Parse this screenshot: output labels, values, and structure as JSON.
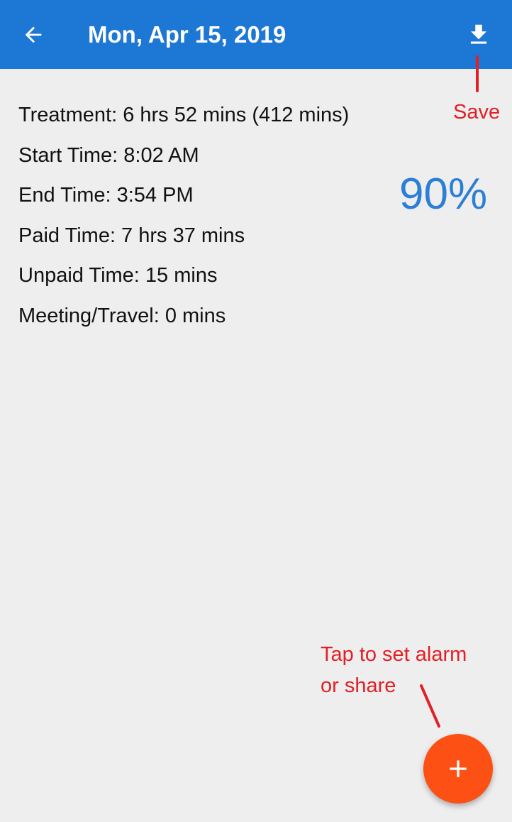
{
  "appbar": {
    "title": "Mon, Apr 15, 2019",
    "back_icon": "arrow-left-icon",
    "save_icon": "download-icon",
    "color": "#1d77d4"
  },
  "details": [
    {
      "text": "Treatment: 6 hrs 52 mins (412 mins)"
    },
    {
      "text": "Start Time: 8:02 AM"
    },
    {
      "text": "End Time: 3:54 PM"
    },
    {
      "text": "Paid Time: 7 hrs 37 mins"
    },
    {
      "text": "Unpaid Time: 15 mins"
    },
    {
      "text": "Meeting/Travel: 0 mins"
    }
  ],
  "productivity": {
    "percent_label": "90%",
    "color": "#2b7fd5"
  },
  "annotations": {
    "save_label": "Save",
    "fab_label_line1": "Tap to set alarm",
    "fab_label_line2": "or share",
    "color": "#e21f26"
  },
  "fab": {
    "icon": "plus-icon",
    "color": "#fc5014"
  }
}
